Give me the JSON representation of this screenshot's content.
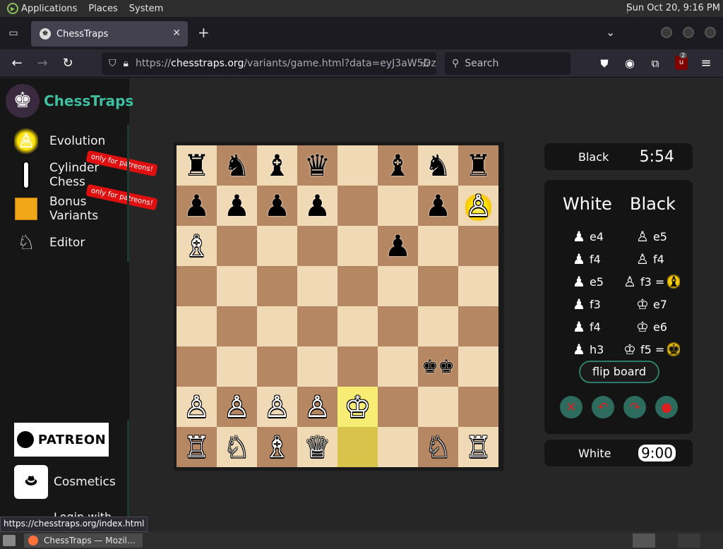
{
  "system_bar": {
    "menus": [
      "Applications",
      "Places",
      "System"
    ],
    "clock": "Sun Oct 20,  9:16 PM"
  },
  "browser": {
    "tab_title": "ChessTraps",
    "url_prefix": "https://",
    "url_host": "chesstraps.org",
    "url_rest": "/variants/game.html?data=eyJ3aW5Dz",
    "search_placeholder": "Search",
    "ubo_badge": "2",
    "status_link": "https://chesstraps.org/index.html"
  },
  "sidebar": {
    "brand": "ChessTraps",
    "items": [
      {
        "label": "Evolution",
        "icon": "fire-pawn-icon"
      },
      {
        "label": "Cylinder Chess",
        "icon": "cylinder-icon",
        "tag": "only for patreons!"
      },
      {
        "label": "Bonus Variants",
        "icon": "bonus-icon",
        "tag": "only for patreons!"
      },
      {
        "label": "Editor",
        "icon": "knight-editor-icon"
      }
    ],
    "patreon_label": "PATREON",
    "cosmetics_label": "Cosmetics",
    "login_label": "Login with"
  },
  "board": {
    "light_color": "#f0d9b5",
    "dark_color": "#b58863",
    "rows": [
      [
        {
          "p": "♜",
          "c": "b"
        },
        {
          "p": "♞",
          "c": "b"
        },
        {
          "p": "♝",
          "c": "b"
        },
        {
          "p": "♛",
          "c": "b"
        },
        null,
        {
          "p": "♝",
          "c": "b"
        },
        {
          "p": "♞",
          "c": "b"
        },
        {
          "p": "♜",
          "c": "b"
        }
      ],
      [
        {
          "p": "♟",
          "c": "b"
        },
        {
          "p": "♟",
          "c": "b"
        },
        {
          "p": "♟",
          "c": "b"
        },
        {
          "p": "♟",
          "c": "b"
        },
        null,
        null,
        {
          "p": "♟",
          "c": "b"
        },
        {
          "p": "♙",
          "c": "w",
          "fire": true
        }
      ],
      [
        {
          "p": "♗",
          "c": "w"
        },
        null,
        null,
        null,
        null,
        {
          "p": "♟",
          "c": "b"
        },
        null,
        null
      ],
      [
        null,
        null,
        null,
        null,
        null,
        null,
        null,
        null
      ],
      [
        null,
        null,
        null,
        null,
        null,
        null,
        null,
        null
      ],
      [
        null,
        null,
        null,
        null,
        null,
        null,
        {
          "p": "♚♚",
          "c": "b"
        },
        null
      ],
      [
        {
          "p": "♙",
          "c": "w"
        },
        {
          "p": "♙",
          "c": "w"
        },
        {
          "p": "♙",
          "c": "w"
        },
        {
          "p": "♙",
          "c": "w"
        },
        {
          "p": "♔",
          "c": "w",
          "hl": true
        },
        null,
        null,
        null
      ],
      [
        {
          "p": "♖",
          "c": "w"
        },
        {
          "p": "♘",
          "c": "w"
        },
        {
          "p": "♗",
          "c": "w"
        },
        {
          "p": "♕",
          "c": "w"
        },
        {
          "p": "",
          "hl": true
        },
        null,
        {
          "p": "♘",
          "c": "w"
        },
        {
          "p": "♖",
          "c": "w"
        }
      ]
    ]
  },
  "clocks": {
    "black_label": "Black",
    "black_time": "5:54",
    "white_label": "White",
    "white_time": "9:00"
  },
  "moves": {
    "white_header": "White",
    "black_header": "Black",
    "list": [
      {
        "w": "e4",
        "wp": "♟",
        "b": "e5",
        "bp": "♙"
      },
      {
        "w": "f4",
        "wp": "♟",
        "b": "f4",
        "bp": "♙"
      },
      {
        "w": "e5",
        "wp": "♟",
        "b": "f3 =",
        "bp": "♙",
        "bx": "♝"
      },
      {
        "w": "f3",
        "wp": "♟",
        "b": "e7",
        "bp": "♔"
      },
      {
        "w": "f4",
        "wp": "♟",
        "b": "e6",
        "bp": "♔"
      },
      {
        "w": "h3",
        "wp": "♟",
        "b": "f5 =",
        "bp": "♔",
        "bx": "♚"
      }
    ],
    "flip_label": "flip board"
  }
}
